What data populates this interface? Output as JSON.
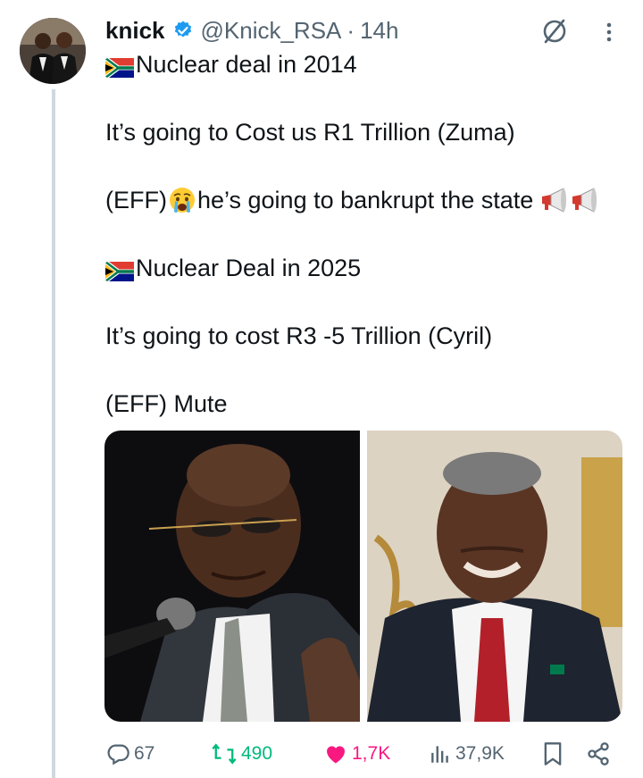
{
  "tweet": {
    "author_name": "knick",
    "handle": "@Knick_RSA",
    "separator": "·",
    "time": "14h",
    "lines": [
      "Nuclear deal  in 2014",
      "It’s going to Cost us R1 Trillion (Zuma)",
      "(EFF)",
      "he’s going to bankrupt the state",
      "Nuclear Deal in 2025",
      "It’s going to cost R3 -5 Trillion (Cyril)",
      "(EFF) Mute"
    ],
    "icons": {
      "verified": "verified-badge-icon",
      "grok": "grok-icon",
      "more": "more-icon",
      "flag": "south-africa-flag-icon",
      "crying": "crying-face-icon",
      "megaphone": "megaphone-icon"
    }
  },
  "actions": {
    "replies": "67",
    "reposts": "490",
    "likes": "1,7K",
    "views": "37,9K"
  },
  "colors": {
    "text": "#0f1419",
    "secondary": "#536471",
    "verified": "#1d9bf0",
    "repost": "#00ba7c",
    "like": "#f91880",
    "thread_line": "#cfd9de"
  }
}
